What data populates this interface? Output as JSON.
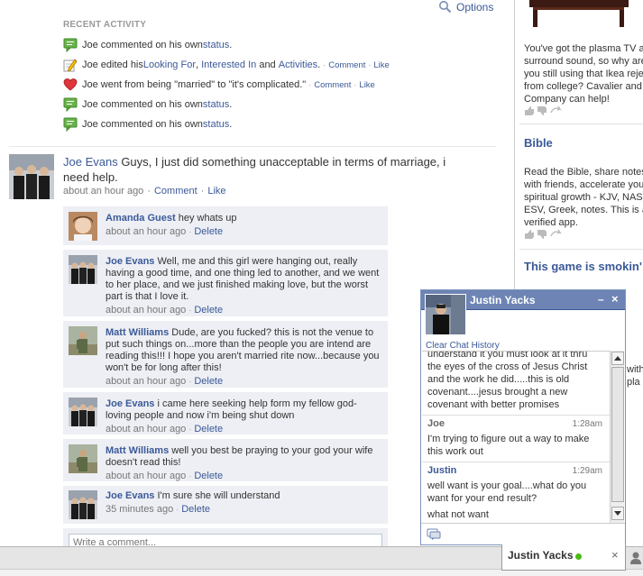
{
  "header": {
    "options_label": "Options"
  },
  "recent_activity": {
    "title": "RECENT ACTIVITY",
    "items": [
      {
        "icon": "status-speech-icon",
        "prefix": "Joe commented on his own ",
        "link": "status",
        "suffix": "."
      },
      {
        "icon": "pencil-edit-icon",
        "prefix": "Joe edited his ",
        "link1": "Looking For",
        "between1": ", ",
        "link2": "Interested In",
        "between2": " and ",
        "link3": "Activities",
        "suffix": ".",
        "comment": "Comment",
        "like": "Like"
      },
      {
        "icon": "heart-icon",
        "text": "Joe went from being \"married\" to \"it's complicated.\"",
        "comment": "Comment",
        "like": "Like"
      },
      {
        "icon": "status-speech-icon",
        "prefix": "Joe commented on his own ",
        "link": "status",
        "suffix": "."
      },
      {
        "icon": "status-speech-icon",
        "prefix": "Joe commented on his own ",
        "link": "status",
        "suffix": "."
      }
    ]
  },
  "post": {
    "author": "Joe Evans",
    "text": " Guys, I just did something unacceptable in terms of marriage, i need help.",
    "time": "about an hour ago",
    "comment_label": "Comment",
    "like_label": "Like"
  },
  "comments": [
    {
      "author": "Amanda Guest",
      "text": "hey whats up",
      "time": "about an hour ago",
      "delete": "Delete"
    },
    {
      "author": "Joe Evans",
      "text": "Well, me and this girl were hanging out, really having a good time, and one thing led to another, and we went to her place, and we just finished making love, but the worst part is that I love it.",
      "time": "about an hour ago",
      "delete": "Delete"
    },
    {
      "author": "Matt Williams",
      "text": "Dude, are you fucked? this is not the venue to put such things on...more than the people you are intend are reading this!!! I hope you aren't married rite now...because you won't be for long after this!",
      "time": "about an hour ago",
      "delete": "Delete"
    },
    {
      "author": "Joe Evans",
      "text": "i came here seeking help form my fellow god-loving people and now i'm being shut down",
      "time": "about an hour ago",
      "delete": "Delete"
    },
    {
      "author": "Matt Williams",
      "text": "well you best be praying to your god your wife doesn't read this!",
      "time": "about an hour ago",
      "delete": "Delete"
    },
    {
      "author": "Joe Evans",
      "text": "I'm sure she will understand",
      "time": "35 minutes ago",
      "delete": "Delete"
    }
  ],
  "write_comment_placeholder": "Write a comment...",
  "sidebar": {
    "ad1_lines": [
      "You've got the plasma TV an",
      "surround sound, so why are",
      "you still using that Ikea reje",
      "from college? Cavalier and",
      "Company can help!"
    ],
    "ad2_title": "Bible",
    "ad2_lines": [
      "Read the Bible, share notes",
      "with friends, accelerate you",
      "spiritual growth - KJV, NASB",
      "ESV, Greek, notes. This is a",
      "verified app."
    ],
    "ad3_title": "This game is smokin'",
    "ad3_fragments": [
      "with",
      "pla"
    ]
  },
  "chat": {
    "name": "Justin Yacks",
    "clear_history": "Clear Chat History",
    "minimize_glyph": "–",
    "close_glyph": "×",
    "lines_top": [
      "understand it you must look at it thru",
      "the eyes of the cross of Jesus Christ",
      "and the work he did.....this is old",
      "covenant....jesus brought a new",
      "covenant with better promises"
    ],
    "msg2_sender": "Joe",
    "msg2_time": "1:28am",
    "msg2_lines": [
      "I'm trying to figure out a way to make",
      "this work out"
    ],
    "msg3_sender": "Justin",
    "msg3_time": "1:29am",
    "msg3_lines": [
      "well want is your goal....what do you",
      "want for your end result?",
      "what not want"
    ]
  },
  "chatbar": {
    "tab_name": "Justin Yacks",
    "tab_close": "×",
    "status": "online"
  },
  "colors": {
    "link": "#3b5998",
    "chat_header": "#6d84b4",
    "comment_bg": "#edeff4",
    "online": "#4cbb17"
  }
}
